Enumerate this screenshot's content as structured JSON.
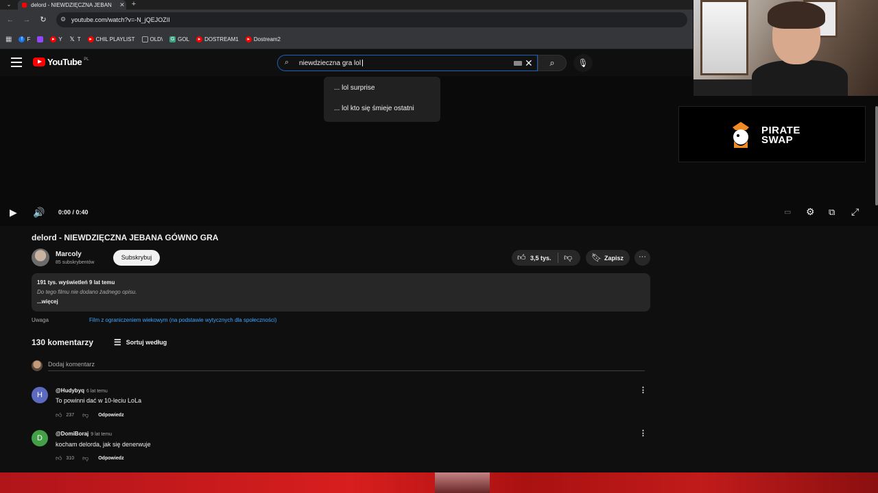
{
  "browser": {
    "tab_title": "delord - NIEWDZIĘCZNA JEBAN",
    "url": "youtube.com/watch?v=-N_jQEJOZII",
    "bookmarks": [
      {
        "label": "F",
        "color": "#1877f2",
        "icon": "facebook-icon"
      },
      {
        "label": "",
        "color": "#9146ff",
        "icon": "twitch-icon"
      },
      {
        "label": "Y",
        "color": "#ff0000",
        "icon": "youtube-icon"
      },
      {
        "label": "T",
        "color": "#000000",
        "icon": "x-icon"
      },
      {
        "label": "CHIL PLAYLIST",
        "color": "#ff0000",
        "icon": "youtube-icon"
      },
      {
        "label": "OLD\\",
        "color": "#aaaaaa",
        "icon": "folder-icon"
      },
      {
        "label": "GOL",
        "color": "#3aa17e",
        "icon": "gol-icon"
      },
      {
        "label": "DOSTREAM1",
        "color": "#ff0000",
        "icon": "youtube-icon"
      },
      {
        "label": "Dostream2",
        "color": "#ff0000",
        "icon": "youtube-icon"
      }
    ]
  },
  "youtube": {
    "logo_text": "YouTube",
    "country_code": "PL",
    "search_query": "niewdzieczna gra lol",
    "suggestions": [
      "... lol surprise",
      "... lol kto się śmieje ostatni"
    ]
  },
  "player": {
    "time": "0:00 / 0:40"
  },
  "sponsor": {
    "line1": "PIRATE",
    "line2": "SWAP"
  },
  "video": {
    "title": "delord - NIEWDZIĘCZNA JEBANA GÓWNO GRA",
    "channel": "Marcoly",
    "subscribers": "85 subskrybentów",
    "subscribe_label": "Subskrybuj",
    "likes": "3,5 tys.",
    "save_label": "Zapisz",
    "views_date": "191 tys. wyświetleń  9 lat temu",
    "description": "Do tego filmu nie dodano żadnego opisu.",
    "more_label": "...więcej",
    "notice_label": "Uwaga",
    "notice_value": "Film z ograniczeniem wiekowym (na podstawie wytycznych dla społeczności)"
  },
  "comments": {
    "count": "130 komentarzy",
    "sort_label": "Sortuj według",
    "add_placeholder": "Dodaj komentarz",
    "reply_label": "Odpowiedz",
    "items": [
      {
        "initial": "H",
        "color": "#5c6bc0",
        "handle": "@Hudybyq",
        "ago": "6 lat temu",
        "text": "To powinni dać w 10-leciu LoLa",
        "likes": "237"
      },
      {
        "initial": "D",
        "color": "#43a047",
        "handle": "@DomiBoraj",
        "ago": "9 lat temu",
        "text": "kocham delorda, jak się denerwuje",
        "likes": "310"
      }
    ]
  }
}
